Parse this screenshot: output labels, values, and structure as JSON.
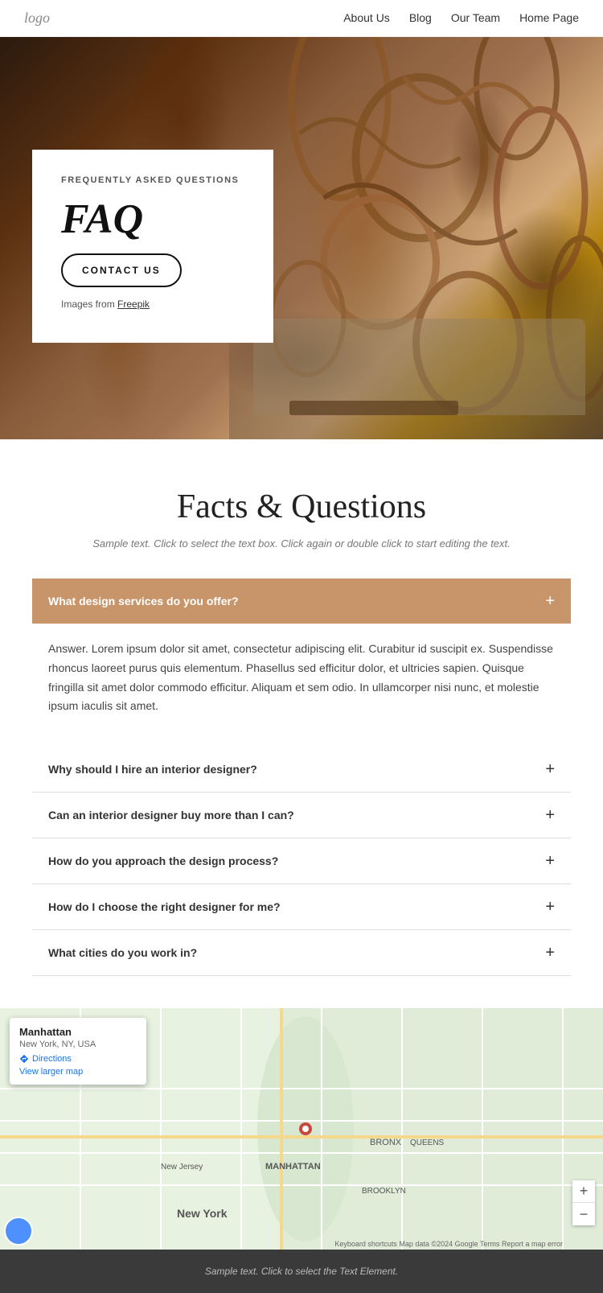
{
  "nav": {
    "logo": "logo",
    "links": [
      {
        "label": "About Us",
        "href": "#"
      },
      {
        "label": "Blog",
        "href": "#"
      },
      {
        "label": "Our Team",
        "href": "#"
      },
      {
        "label": "Home Page",
        "href": "#"
      }
    ]
  },
  "hero": {
    "subtitle": "FREQUENTLY ASKED QUESTIONS",
    "title": "FAQ",
    "button_label": "CONTACT US",
    "images_text": "Images from ",
    "images_link": "Freepik"
  },
  "faq_section": {
    "title": "Facts & Questions",
    "subtitle": "Sample text. Click to select the text box. Click again or double click to start editing the text.",
    "active_question": "What design services do you offer?",
    "active_answer": "Answer. Lorem ipsum dolor sit amet, consectetur adipiscing elit. Curabitur id suscipit ex. Suspendisse rhoncus laoreet purus quis elementum. Phasellus sed efficitur dolor, et ultricies sapien. Quisque fringilla sit amet dolor commodo efficitur. Aliquam et sem odio. In ullamcorper nisi nunc, et molestie ipsum iaculis sit amet.",
    "questions": [
      {
        "label": "Why should I hire an interior designer?"
      },
      {
        "label": "Can an interior designer buy more than I can?"
      },
      {
        "label": "How do you approach the design process?"
      },
      {
        "label": "How do I choose the right designer for me?"
      },
      {
        "label": "What cities do you work in?"
      }
    ]
  },
  "map": {
    "popup_title": "Manhattan",
    "popup_address": "New York, NY, USA",
    "directions_label": "Directions",
    "larger_map_label": "View larger map",
    "attribution": "Keyboard shortcuts  Map data ©2024 Google  Terms  Report a map error",
    "zoom_in": "+",
    "zoom_out": "−"
  },
  "footer": {
    "text": "Sample text. Click to select the Text Element."
  }
}
